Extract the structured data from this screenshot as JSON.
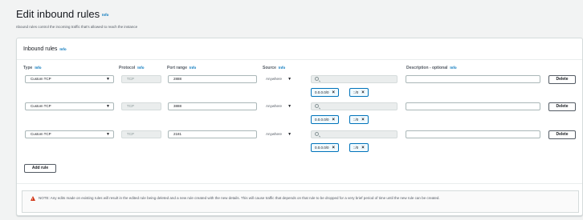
{
  "header": {
    "title": "Edit inbound rules",
    "info": "Info",
    "subtitle": "nbound rules control the incoming traffic that's allowed to reach the instance"
  },
  "panel": {
    "title": "Inbound rules",
    "info": "Info"
  },
  "columns": {
    "type": "Type",
    "protocol": "Protocol",
    "port_range": "Port range",
    "source": "Source",
    "description": "Description - optional",
    "info": "Info"
  },
  "rules": [
    {
      "type": "Custom TCP",
      "protocol": "TCP",
      "port": "2888",
      "source": "Anywhere",
      "search_value": "",
      "tokens": [
        "0.0.0.0/0",
        "::/0"
      ],
      "description": "",
      "delete_label": "Delete"
    },
    {
      "type": "Custom TCP",
      "protocol": "TCP",
      "port": "3888",
      "source": "Anywhere",
      "search_value": "",
      "tokens": [
        "0.0.0.0/0",
        "::/0"
      ],
      "description": "",
      "delete_label": "Delete"
    },
    {
      "type": "Custom TCP",
      "protocol": "TCP",
      "port": "2181",
      "source": "Anywhere",
      "search_value": "",
      "tokens": [
        "0.0.0.0/0",
        "::/0"
      ],
      "description": "",
      "delete_label": "Delete"
    }
  ],
  "add_rule_label": "Add rule",
  "note": "NOTE: Any edits made on existing rules will result in the edited rule being deleted and a new rule created with the new details. This will cause traffic that depends on that rule to be dropped for a very brief period of time until the new rule can be created.",
  "colors": {
    "accent": "#0073bb",
    "warning": "#d13212",
    "background": "#f2f3f3"
  },
  "icons": [
    "search-icon",
    "close-icon",
    "caret-down-icon",
    "warning-icon"
  ]
}
